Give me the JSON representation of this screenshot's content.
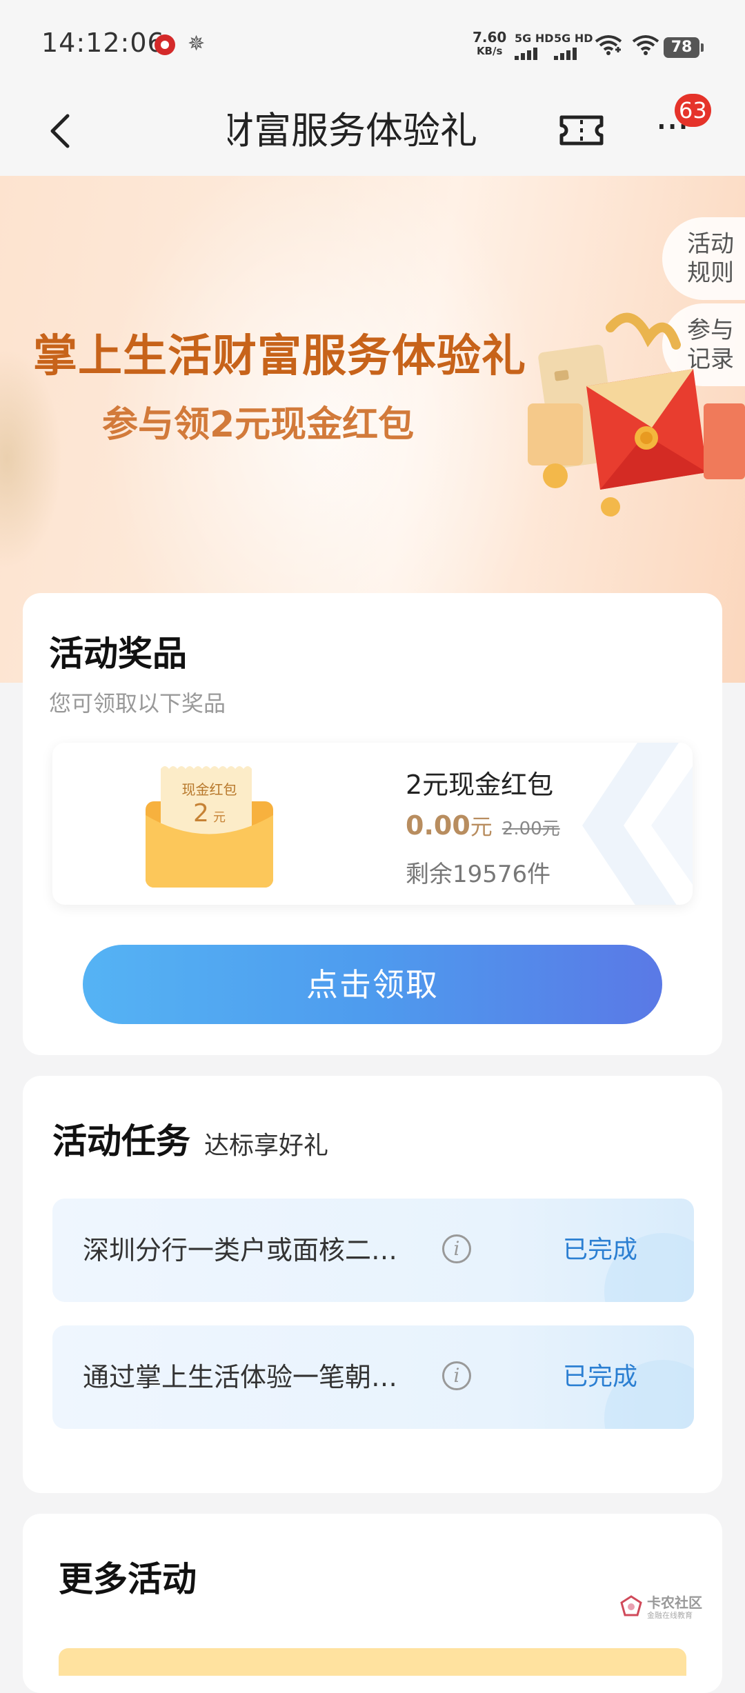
{
  "status_bar": {
    "time": "14:12:06",
    "net_speed_value": "7.60",
    "net_speed_unit": "KB/s",
    "sim1_label": "5G HD",
    "sim2_label": "5G HD",
    "battery": "78"
  },
  "nav": {
    "title": "掌上生活财富服务体验礼",
    "more_label": "···",
    "badge_count": "63"
  },
  "banner": {
    "title": "掌上生活财富服务体验礼",
    "subtitle": "参与领2元现金红包",
    "rules_line1": "活动",
    "rules_line2": "规则",
    "records_line1": "参与",
    "records_line2": "记录"
  },
  "prize_section": {
    "heading": "活动奖品",
    "subheading": "您可领取以下奖品",
    "envelope_label": "现金红包",
    "envelope_amount": "2",
    "envelope_unit": "元",
    "prize_name": "2元现金红包",
    "price": "0.00",
    "price_unit": "元",
    "original_price": "2.00元",
    "remaining": "剩余19576件",
    "claim_button": "点击领取"
  },
  "task_section": {
    "heading": "活动任务",
    "subheading": "达标享好礼",
    "info_glyph": "i",
    "tasks": [
      {
        "text": "深圳分行一类户或面核二…",
        "status": "已完成"
      },
      {
        "text": "通过掌上生活体验一笔朝…",
        "status": "已完成"
      }
    ]
  },
  "more_section": {
    "heading": "更多活动"
  },
  "watermark": {
    "line1": "卡农社区",
    "line2": "金融在线教育"
  },
  "colors": {
    "accent_blue": "#4e9bee",
    "banner_title": "#c7631a",
    "badge_red": "#e5332a",
    "status_blue": "#2b7fd2",
    "price_gold": "#b88d5f"
  },
  "icons": [
    "back-arrow-icon",
    "ticket-icon",
    "more-icon",
    "info-icon",
    "gift-envelope-icon",
    "red-envelope-icon",
    "wifi-icon",
    "battery-icon"
  ]
}
